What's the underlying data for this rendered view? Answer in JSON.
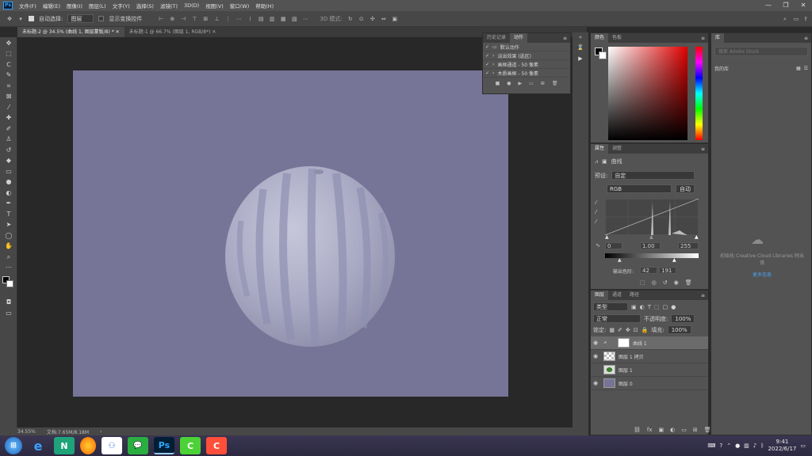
{
  "menu": [
    "文件(F)",
    "编辑(E)",
    "图像(I)",
    "图层(L)",
    "文字(Y)",
    "选择(S)",
    "滤镜(T)",
    "3D(D)",
    "视图(V)",
    "窗口(W)",
    "帮助(H)"
  ],
  "window_controls": {
    "minimize": "—",
    "restore": "❐",
    "close": "✕"
  },
  "options": {
    "auto_select": "自动选择:",
    "auto_select_target": "图层",
    "show_transform": "显示变换控件",
    "mode_3d": "3D 模式:"
  },
  "tabs": [
    {
      "label": "未标题-2 @ 34.5% (曲线 1, 图层蒙版/8) *",
      "active": true
    },
    {
      "label": "未标题-1 @ 66.7% (图层 1, RGB/8*)",
      "active": false
    }
  ],
  "status": {
    "zoom": "34.55%",
    "doc": "文档:7.65M/8.18M"
  },
  "actions_panel": {
    "tabs": [
      "历史记录",
      "动作"
    ],
    "rows": [
      {
        "checked": true,
        "label": "默认动作"
      },
      {
        "checked": true,
        "label": "淡出效果 (选区)"
      },
      {
        "checked": true,
        "label": "画框通道 - 50 像素"
      },
      {
        "checked": true,
        "label": "木质画框 - 50 像素"
      }
    ]
  },
  "color_panel": {
    "tabs": [
      "颜色",
      "色板"
    ]
  },
  "adjust_panel": {
    "tabs": [
      "属性",
      "调整"
    ],
    "adj_name": "曲线",
    "preset_label": "预设:",
    "preset_value": "自定",
    "channel": "RGB",
    "auto_label": "自动",
    "input_black": "0",
    "input_gamma": "1.00",
    "input_white": "255",
    "output_label": "输出色阶:",
    "output_black": "42",
    "output_white": "191"
  },
  "layers_panel": {
    "tabs": [
      "图层",
      "通道",
      "路径"
    ],
    "filter": "类型",
    "blend_mode": "正常",
    "opacity_label": "不透明度:",
    "opacity": "100%",
    "lock_label": "锁定:",
    "fill_label": "填充:",
    "fill": "100%",
    "layers": [
      {
        "name": "曲线 1",
        "visible": true,
        "selected": true,
        "kind": "adjustment"
      },
      {
        "name": "图层 1 拷贝",
        "visible": true,
        "selected": false,
        "kind": "image"
      },
      {
        "name": "图层 1",
        "visible": false,
        "selected": false,
        "kind": "image"
      },
      {
        "name": "图层 0",
        "visible": true,
        "selected": false,
        "kind": "fill"
      }
    ]
  },
  "library_panel": {
    "tab": "库",
    "search_placeholder": "搜索 Adobe Stock",
    "lib_name": "我的库",
    "sync_msg": "初始化 Creative Cloud Libraries 时出错",
    "link": "更多信息"
  },
  "taskbar": {
    "time": "9:41",
    "date": "2022/6/17"
  }
}
